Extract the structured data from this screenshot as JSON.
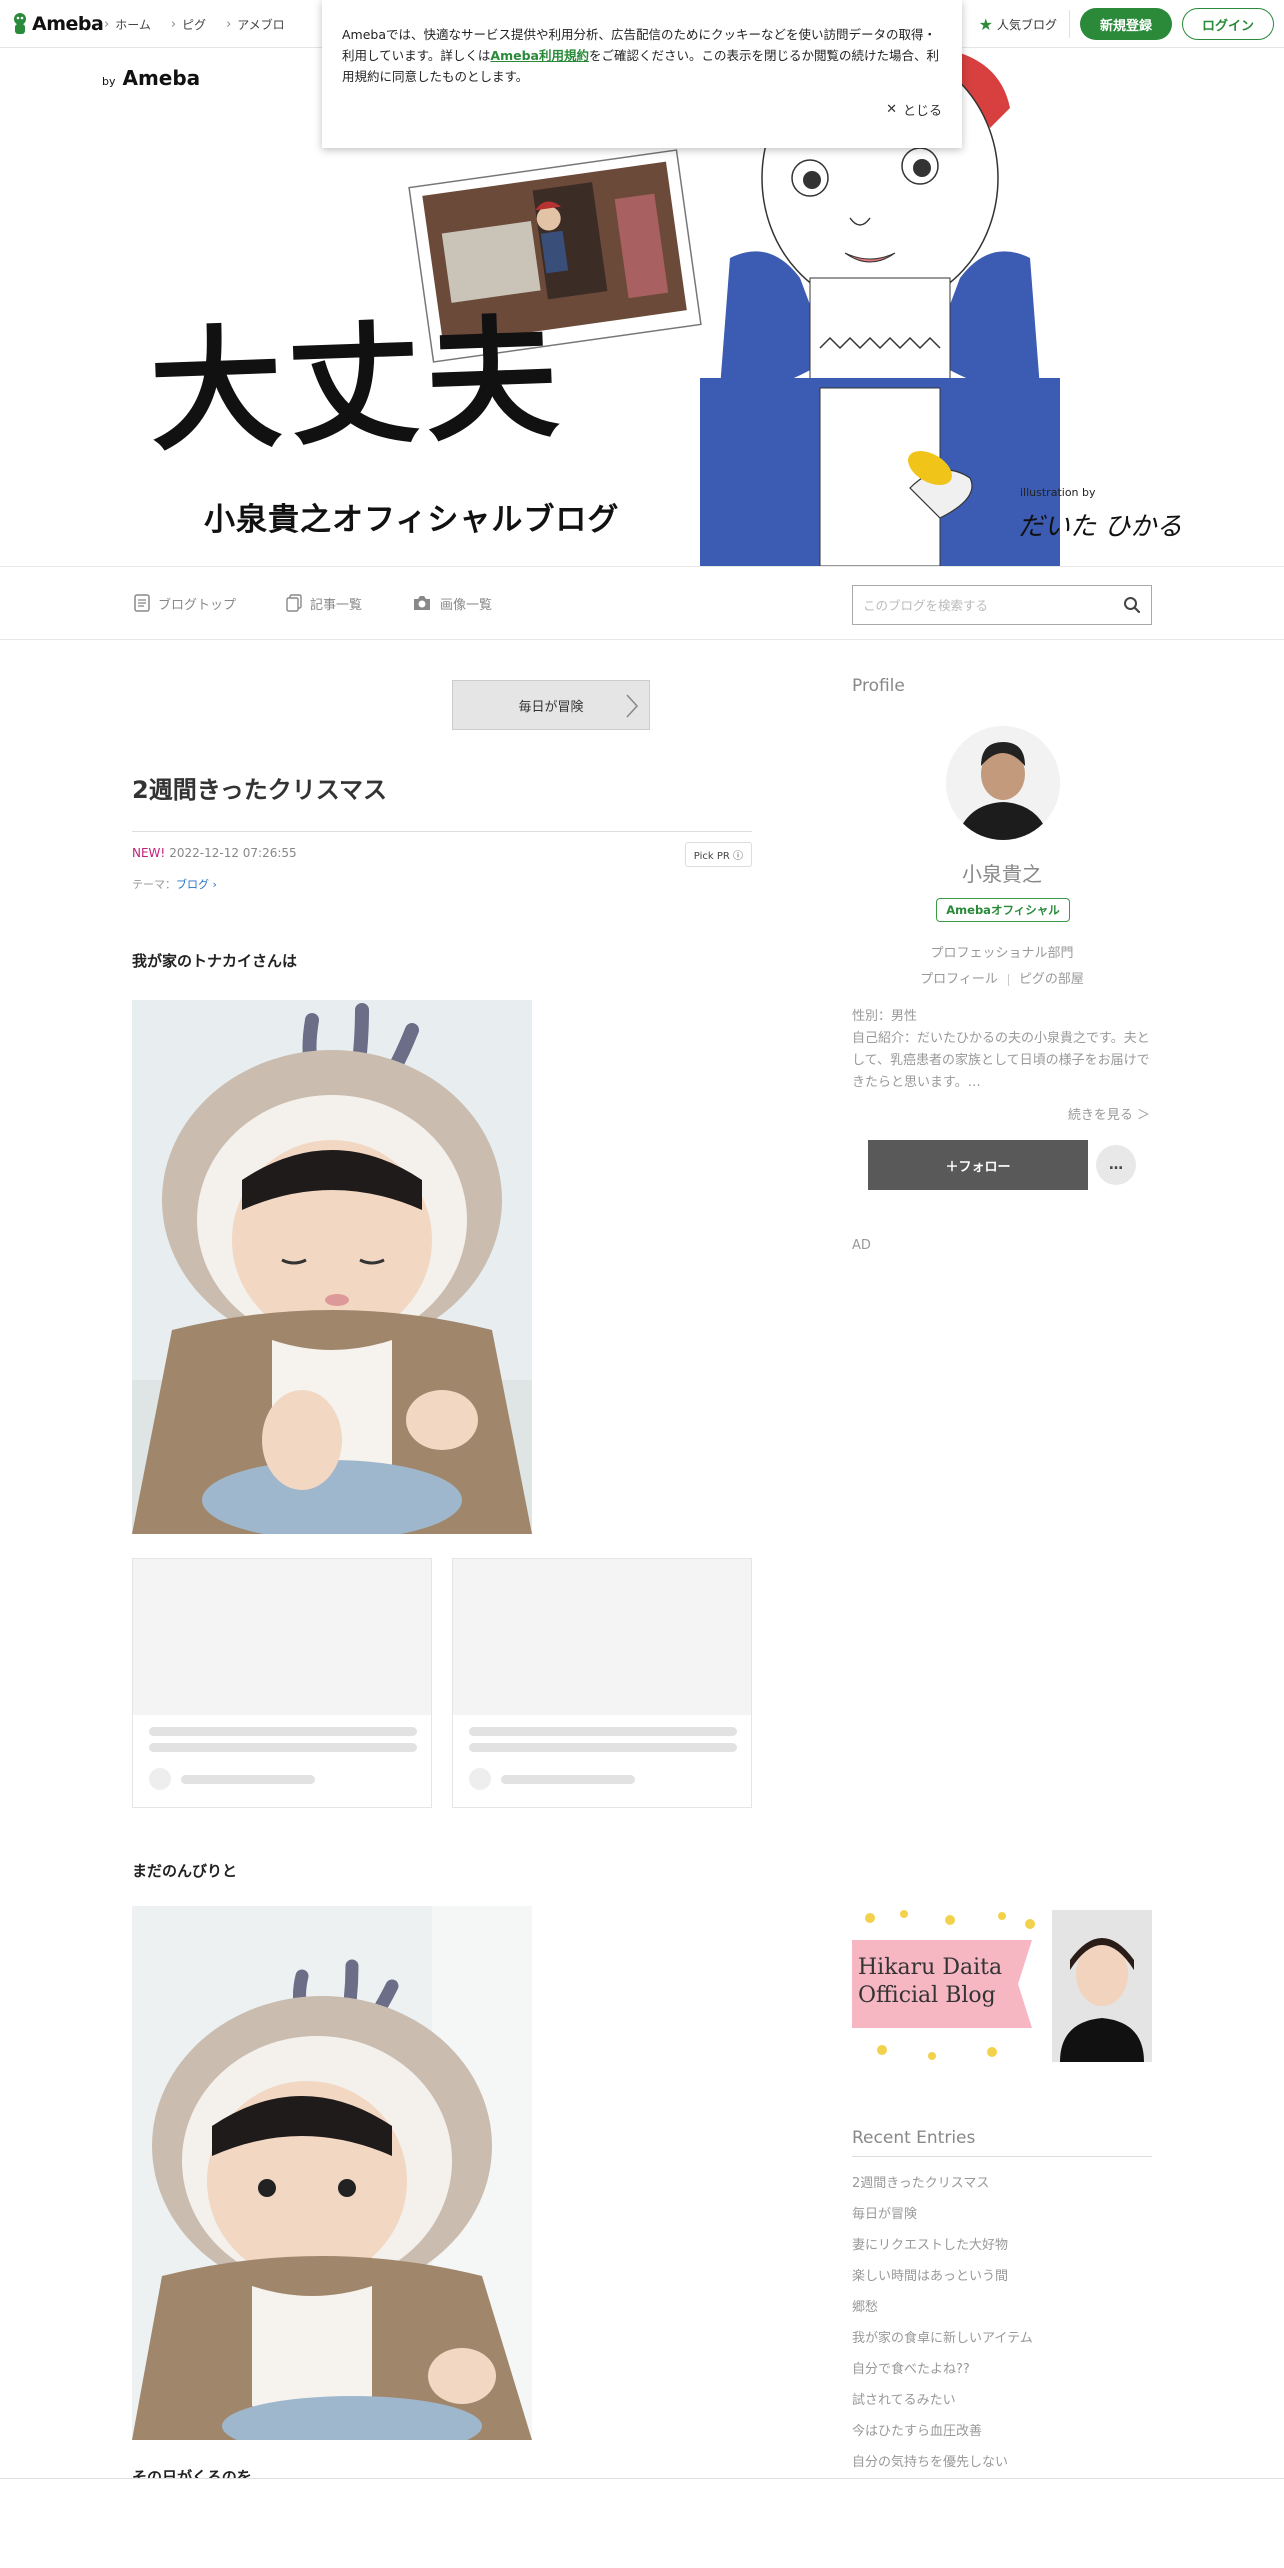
{
  "global_header": {
    "logo": "Ameba",
    "nav": [
      "ホーム",
      "ピグ",
      "アメブロ"
    ],
    "popular": "人気ブログ",
    "signup": "新規登録",
    "login": "ログイン"
  },
  "cookie": {
    "text_before": "Amebaでは、快適なサービス提供や利用分析、広告配信のためにクッキーなどを使い訪問データの取得・利用しています。詳しくは",
    "link": "Ameba利用規約",
    "text_after": "をご確認ください。この表示を閉じるか閲覧の続けた場合、利用規約に同意したものとします。",
    "close": "とじる"
  },
  "hero": {
    "by": "by",
    "brand": "Ameba",
    "title": "大丈夫",
    "subtitle": "小泉貴之オフィシャルブログ",
    "illustration_by": "illustration by",
    "signature": "だいた ひかる"
  },
  "blog_nav": {
    "items": [
      "ブログトップ",
      "記事一覧",
      "画像一覧"
    ],
    "search_placeholder": "このブログを検索する"
  },
  "article": {
    "prev_link": "毎日が冒険",
    "title": "2週間きったクリスマス",
    "new_label": "NEW!",
    "date": "2022-12-12 07:26:55",
    "pick_pr": "Pick PR ⓘ",
    "theme_label": "テーマ：",
    "theme": "ブログ",
    "para1": "我が家のトナカイさんは",
    "para2": "まだのんびりと",
    "para3": "その日がくるのを"
  },
  "profile": {
    "heading": "Profile",
    "name": "小泉貴之",
    "badge": "Amebaオフィシャル",
    "division": "プロフェッショナル部門",
    "link1": "プロフィール",
    "link2": "ピグの部屋",
    "bio": "性別：男性\n自己紹介：だいたひかるの夫の小泉貴之です。夫として、乳癌患者の家族として日頃の様子をお届けできたらと思います。…",
    "more": "続きを見る ＞",
    "follow": "＋フォロー",
    "menu": "…",
    "ad": "AD"
  },
  "banner": {
    "line1": "Hikaru Daita",
    "line2": "Official Blog"
  },
  "recent": {
    "heading": "Recent Entries",
    "items": [
      "2週間きったクリスマス",
      "毎日が冒険",
      "妻にリクエストした大好物",
      "楽しい時間はあっという間",
      "郷愁",
      "我が家の食卓に新しいアイテム",
      "自分で食べたよね??",
      "試されてるみたい",
      "今はひたすら血圧改善",
      "自分の気持ちを優先しない"
    ]
  },
  "colors": {
    "brand_green": "#2a8a3a",
    "new_pink": "#c41e7a"
  }
}
